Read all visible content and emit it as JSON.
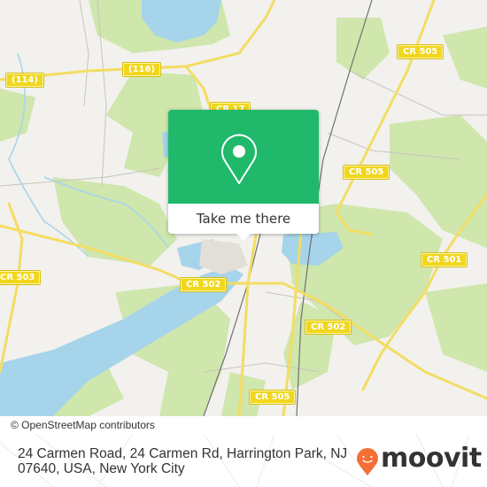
{
  "map": {
    "colors": {
      "land": "#f2f1ed",
      "park": "#cfe6ad",
      "water": "#a6d4ea",
      "road_major": "#f3dd63",
      "road_minor": "#c8c4bd",
      "rail": "#707070"
    },
    "road_labels": [
      {
        "id": "route-116",
        "text": "(116)"
      },
      {
        "id": "route-114",
        "text": "(114)"
      },
      {
        "id": "cr-17",
        "text": "CR 17"
      },
      {
        "id": "cr-505-north",
        "text": "CR 505"
      },
      {
        "id": "cr-505-mid",
        "text": "CR 505"
      },
      {
        "id": "cr-505-south",
        "text": "CR 505"
      },
      {
        "id": "cr-503",
        "text": "CR 503"
      },
      {
        "id": "cr-502-west",
        "text": "CR 502"
      },
      {
        "id": "cr-502-east",
        "text": "CR 502"
      },
      {
        "id": "cr-501",
        "text": "CR 501"
      }
    ],
    "attribution": "© OpenStreetMap contributors"
  },
  "popup": {
    "icon": "map-pin-icon",
    "button_label": "Take me there",
    "accent_color": "#20b96b"
  },
  "footer": {
    "address": "24 Carmen Road, 24 Carmen Rd, Harrington Park, NJ 07640, USA, New York City",
    "brand": "moovit",
    "brand_icon": "moovit-pin-logo-icon",
    "brand_color": "#f36f35"
  }
}
